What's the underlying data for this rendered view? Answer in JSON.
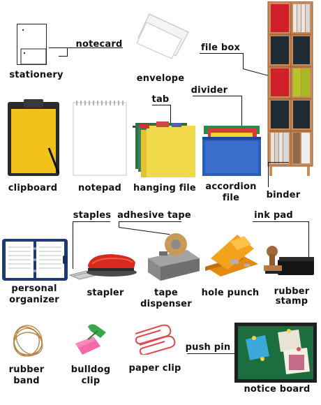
{
  "labels": {
    "stationery": "stationery",
    "notecard": "notecard",
    "envelope": "envelope",
    "file_box": "file box",
    "tab": "tab",
    "divider": "divider",
    "clipboard": "clipboard",
    "notepad": "notepad",
    "hanging_file": "hanging file",
    "accordion_file_1": "accordion",
    "accordion_file_2": "file",
    "binder": "binder",
    "staples": "staples",
    "adhesive_tape": "adhesive tape",
    "ink_pad": "ink pad",
    "personal_organizer_1": "personal",
    "personal_organizer_2": "organizer",
    "stapler": "stapler",
    "tape_dispenser_1": "tape",
    "tape_dispenser_2": "dispenser",
    "hole_punch": "hole punch",
    "rubber_stamp_1": "rubber",
    "rubber_stamp_2": "stamp",
    "rubber_band_1": "rubber",
    "rubber_band_2": "band",
    "bulldog_clip_1": "bulldog",
    "bulldog_clip_2": "clip",
    "paper_clip": "paper clip",
    "push_pin": "push pin",
    "notice_board": "notice board"
  }
}
